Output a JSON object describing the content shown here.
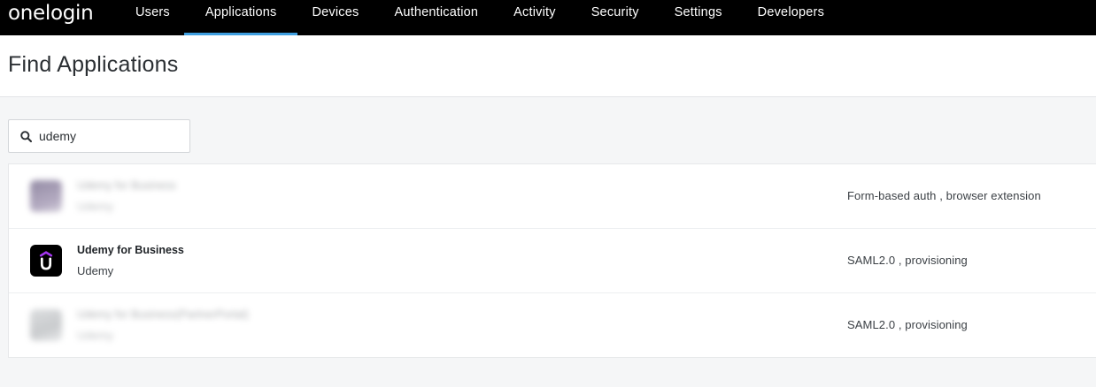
{
  "brand": {
    "logo_text": "onelogin"
  },
  "nav": {
    "items": [
      {
        "label": "Users",
        "active": false
      },
      {
        "label": "Applications",
        "active": true
      },
      {
        "label": "Devices",
        "active": false
      },
      {
        "label": "Authentication",
        "active": false
      },
      {
        "label": "Activity",
        "active": false
      },
      {
        "label": "Security",
        "active": false
      },
      {
        "label": "Settings",
        "active": false
      },
      {
        "label": "Developers",
        "active": false
      }
    ],
    "active_color": "#3f9fe0"
  },
  "page": {
    "title": "Find Applications"
  },
  "search": {
    "value": "udemy",
    "icon": "search-icon"
  },
  "results": [
    {
      "name": "Udemy for Business",
      "vendor": "Udemy",
      "auth": "Form-based auth , browser extension",
      "blurred": true
    },
    {
      "name": "Udemy for Business",
      "vendor": "Udemy",
      "auth": "SAML2.0 , provisioning",
      "blurred": false,
      "icon": "udemy-logo-icon"
    },
    {
      "name": "Udemy for Business(PartnerPortal)",
      "vendor": "Udemy",
      "auth": "SAML2.0 , provisioning",
      "blurred": true
    }
  ]
}
